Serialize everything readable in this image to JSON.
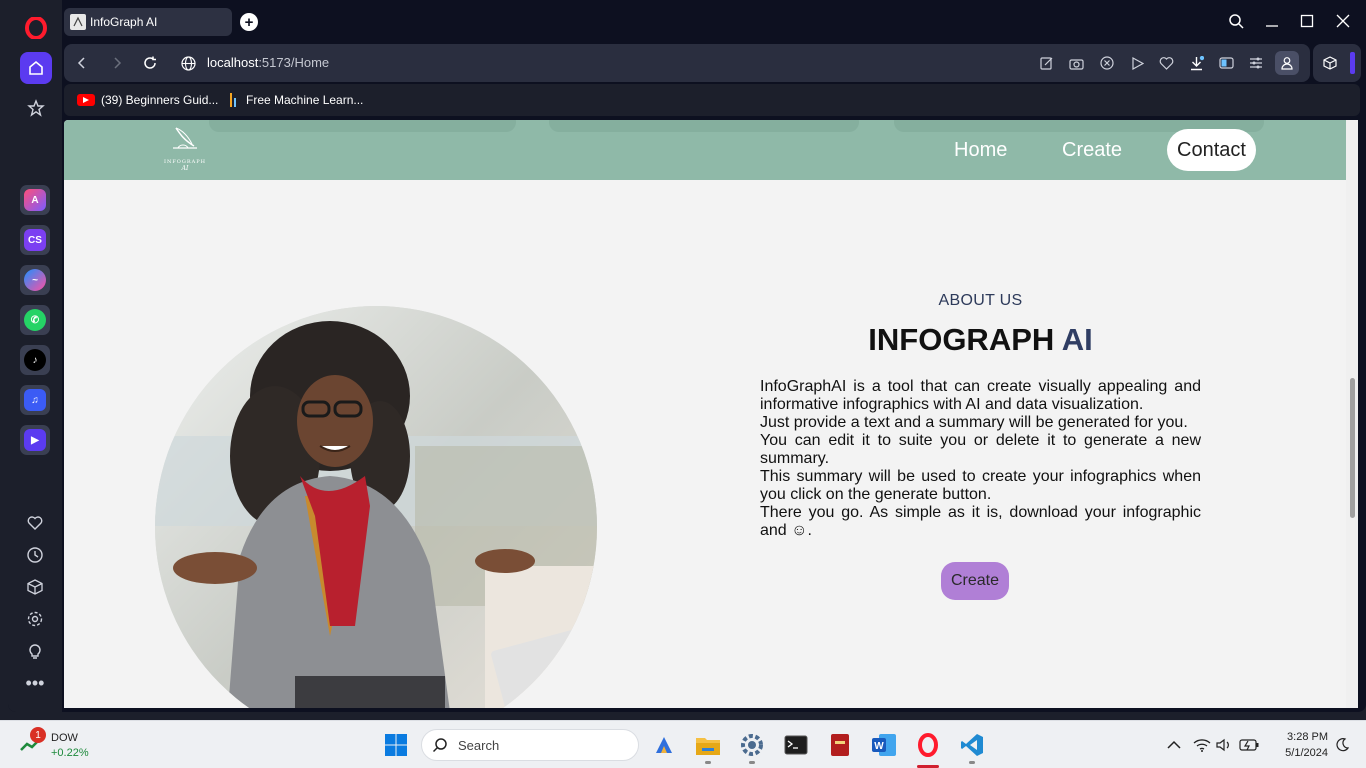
{
  "browser": {
    "tab_title": "InfoGraph AI",
    "url_host": "localhost",
    "url_path": ":5173/Home",
    "bookmarks": [
      {
        "label": "(39) Beginners Guid...",
        "icon": "youtube-icon"
      },
      {
        "label": "Free Machine Learn...",
        "icon": "bookmark-bars-icon"
      }
    ],
    "sidebar_apps": [
      "app-store-icon",
      "cs-app-icon",
      "messenger-icon",
      "whatsapp-icon",
      "tiktok-icon",
      "music-player-icon",
      "video-player-icon"
    ],
    "sidebar_bottom": [
      "heart-icon",
      "history-icon",
      "cube-icon",
      "settings-icon",
      "lightbulb-icon",
      "more-icon"
    ],
    "accent": "#5b3bf0"
  },
  "site": {
    "logo_text": "INFOGRAPH",
    "logo_sub": "AI",
    "nav": {
      "home": "Home",
      "create": "Create",
      "contact": "Contact"
    },
    "nav_bg": "#8fb9a8",
    "about": {
      "label": "ABOUT US",
      "title_main": "INFOGRAPH",
      "title_accent": "AI",
      "paragraphs": [
        "InfoGraphAI is a tool that can create visually appealing and informative infographics with AI and data visualization.",
        "Just provide a text and a summary will be generated for you.",
        "You can edit it to suite you or delete it to generate a new summary.",
        "This summary will be used to create your infographics when you click on the generate button.",
        "There you go. As simple as it is, download your infographic and"
      ],
      "smiley": "☺",
      "period": ".",
      "cta": "Create",
      "cta_color": "#b07fd6"
    }
  },
  "taskbar": {
    "stock_name": "DOW",
    "stock_change": "+0.22%",
    "stock_badge": "1",
    "search_placeholder": "Search",
    "time": "3:28 PM",
    "date": "5/1/2024"
  }
}
